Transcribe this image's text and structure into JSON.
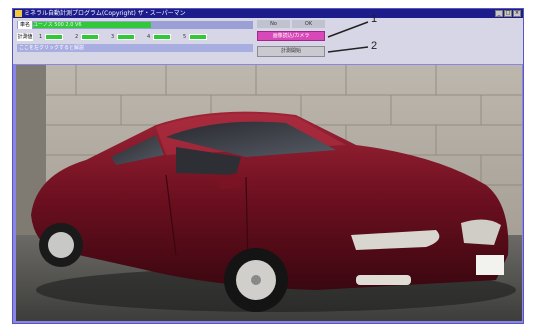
{
  "window": {
    "title": "ミネラル自動計測プログラム(Copyright) ザ・スーパーマン",
    "controls": [
      "_",
      "□",
      "×"
    ]
  },
  "toolbar": {
    "row1_label": "車名",
    "row1_value": "ユーノス 500 2.0 V6",
    "row2_label": "計測値",
    "row2_segments": [
      "1",
      "2",
      "3",
      "4",
      "5"
    ],
    "row3_text": "ここを左クリックすると解説"
  },
  "right_panel": {
    "tiny_buttons": [
      "No",
      "OK"
    ],
    "primary_button": "画像読込/カメラ",
    "secondary_button": "計測開始"
  },
  "callouts": [
    "1",
    "2"
  ],
  "colors": {
    "accent_pink": "#d948b8",
    "status_green": "#31c83a",
    "window_blue": "#8a86e6"
  }
}
